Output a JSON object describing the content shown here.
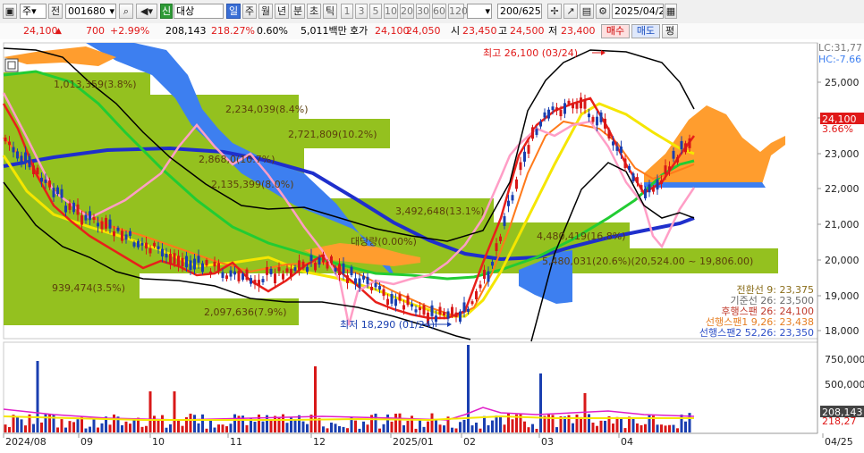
{
  "toolbar": {
    "period_main": "주",
    "prev_label": "전",
    "stock_code": "001680",
    "badge_new": "신",
    "stock_name": "대상",
    "periods": [
      "일",
      "주",
      "월",
      "년",
      "분",
      "초",
      "틱"
    ],
    "minutes": [
      "1",
      "3",
      "5",
      "10",
      "20",
      "30",
      "60",
      "120"
    ],
    "range": "200/625",
    "date": "2025/04/25"
  },
  "info": {
    "price": "24,100",
    "change": "700",
    "change_pct": "+2.99%",
    "volume": "208,143",
    "volume_ratio": "218.27%",
    "turnover": "0.60%",
    "amount": "5,011백만",
    "quote_label": "호가",
    "ask": "24,100",
    "bid": "24,050",
    "open_label": "시",
    "open": "23,450",
    "high_label": "고",
    "high": "24,500",
    "low_label": "저",
    "low": "23,400",
    "buy_button": "매수",
    "sell_button": "매도",
    "eval_button": "평"
  },
  "corner": {
    "lc": "LC:31,77",
    "hc": "HC:-7.66"
  },
  "price_axis": [
    "25,000",
    "24,000",
    "23,000",
    "22,000",
    "21,000",
    "20,000",
    "19,000",
    "18,000"
  ],
  "current_tag": {
    "price": "24,100",
    "pct": "3.66%"
  },
  "volume_axis": [
    "750,000",
    "500,000",
    "250,000"
  ],
  "volume_tags": [
    "208,143",
    "218,27"
  ],
  "date_axis": [
    "2024/08",
    "09",
    "10",
    "11",
    "12",
    "2025/01",
    "02",
    "03",
    "04",
    "04/25"
  ],
  "annotations": {
    "high": "최고 26,100 (03/24)",
    "low": "최저 18,290 (01/24)"
  },
  "profile_labels": [
    "1,013,359(3.8%)",
    "2,234,039(8.4%)",
    "2,721,809(10.2%)",
    "2,868,0(10.7%)",
    "2,135,399(8.0%)",
    "3,492,648(13.1%)",
    "대당량(0.00%)",
    "4,480,419(16.8%)",
    "5,480,031(20.6%)(20,524.00 ~ 19,806.00)",
    "939,474(3.5%)",
    "2,097,636(7.9%)"
  ],
  "legend": [
    {
      "text": "전환선 9: 23,375",
      "color": "#8a6d1a"
    },
    {
      "text": "기준선 26: 23,500",
      "color": "#6b6b6b"
    },
    {
      "text": "후행스팬 26: 24,100",
      "color": "#c0392b"
    },
    {
      "text": "선행스팬1 9,26: 23,438",
      "color": "#e67e22"
    },
    {
      "text": "선행스팬2 52,26: 23,350",
      "color": "#2e50c8"
    }
  ],
  "colors": {
    "cloud_orange": "#ff9d2e",
    "cloud_blue": "#3d7ff0",
    "profile_green": "#94c11f",
    "ma_blue": "#1f2fcc",
    "ma_green": "#22cc33",
    "ma_yellow": "#f5e600",
    "ma_red": "#e8201a",
    "ma_pink": "#ff9ec6",
    "candle_up": "#d81818",
    "candle_down": "#1a3fb0"
  }
}
